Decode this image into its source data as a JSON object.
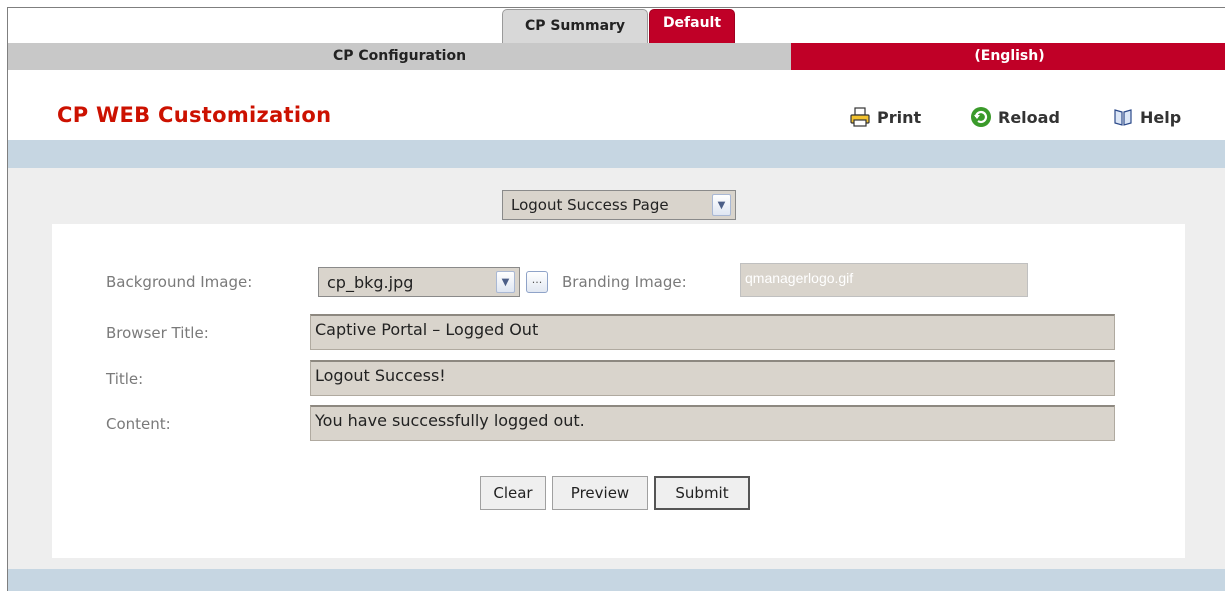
{
  "tabs": [
    {
      "label": "CP Summary",
      "active": false
    },
    {
      "label": "Default",
      "active": true
    }
  ],
  "header": {
    "section": "CP Configuration",
    "language": "(English)"
  },
  "page": {
    "title": "CP WEB Customization"
  },
  "toolbar": {
    "print": {
      "label": "Print",
      "icon": "printer-icon"
    },
    "reload": {
      "label": "Reload",
      "icon": "reload-icon"
    },
    "help": {
      "label": "Help",
      "icon": "help-book-icon"
    }
  },
  "page_select": {
    "value": "Logout Success Page"
  },
  "form": {
    "background_image": {
      "label": "Background Image:",
      "value": "cp_bkg.jpg",
      "browse_label": "..."
    },
    "branding_image": {
      "label": "Branding Image:",
      "value": "qmanagerlogo.gif"
    },
    "browser_title": {
      "label": "Browser Title:",
      "value": "Captive Portal – Logged Out"
    },
    "title": {
      "label": "Title:",
      "value": "Logout Success!"
    },
    "content": {
      "label": "Content:",
      "value": "You have successfully logged out."
    }
  },
  "buttons": {
    "clear": "Clear",
    "preview": "Preview",
    "submit": "Submit"
  },
  "colors": {
    "accent_red": "#c00027",
    "title_red": "#cc1100",
    "band_blue": "#c6d6e2",
    "field_bg": "#d9d4cc"
  }
}
